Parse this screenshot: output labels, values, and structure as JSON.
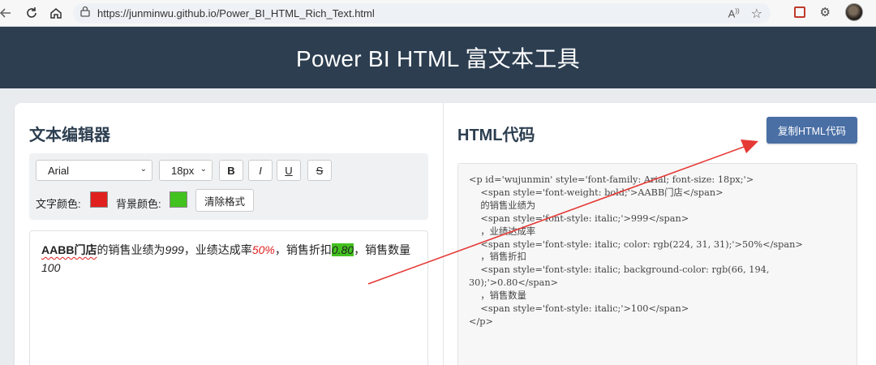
{
  "browser": {
    "url": "https://junminwu.github.io/Power_BI_HTML_Rich_Text.html"
  },
  "header": {
    "title": "Power BI HTML 富文本工具"
  },
  "editor_panel": {
    "title": "文本编辑器",
    "font_value": "Arial",
    "size_value": "18px",
    "bold_label": "B",
    "italic_label": "I",
    "underline_label": "U",
    "strike_label": "S",
    "text_color_label": "文字颜色:",
    "bg_color_label": "背景颜色:",
    "text_color": "#e0201f",
    "bg_color": "#42c21e",
    "clear_label": "清除格式",
    "content": {
      "bold_text": "AABB门店",
      "t1": "的销售业绩为",
      "v1": "999",
      "t2": "，业绩达成率",
      "v2": "50%",
      "t3": "，销售折扣",
      "v3": "0.80",
      "t4": "，销售数量",
      "v4": "100"
    }
  },
  "code_panel": {
    "title": "HTML代码",
    "copy_label": "复制HTML代码",
    "code": "<p id='wujunmin' style='font-family: Arial; font-size: 18px;'>\n    <span style='font-weight: bold;'>AABB门店</span>\n    的销售业绩为\n    <span style='font-style: italic;'>999</span>\n    ，业绩达成率\n    <span style='font-style: italic; color: rgb(224, 31, 31);'>50%</span>\n    ，销售折扣\n    <span style='font-style: italic; background-color: rgb(66, 194, 30);'>0.80</span>\n    ，销售数量\n    <span style='font-style: italic;'>100</span>\n</p>"
  }
}
